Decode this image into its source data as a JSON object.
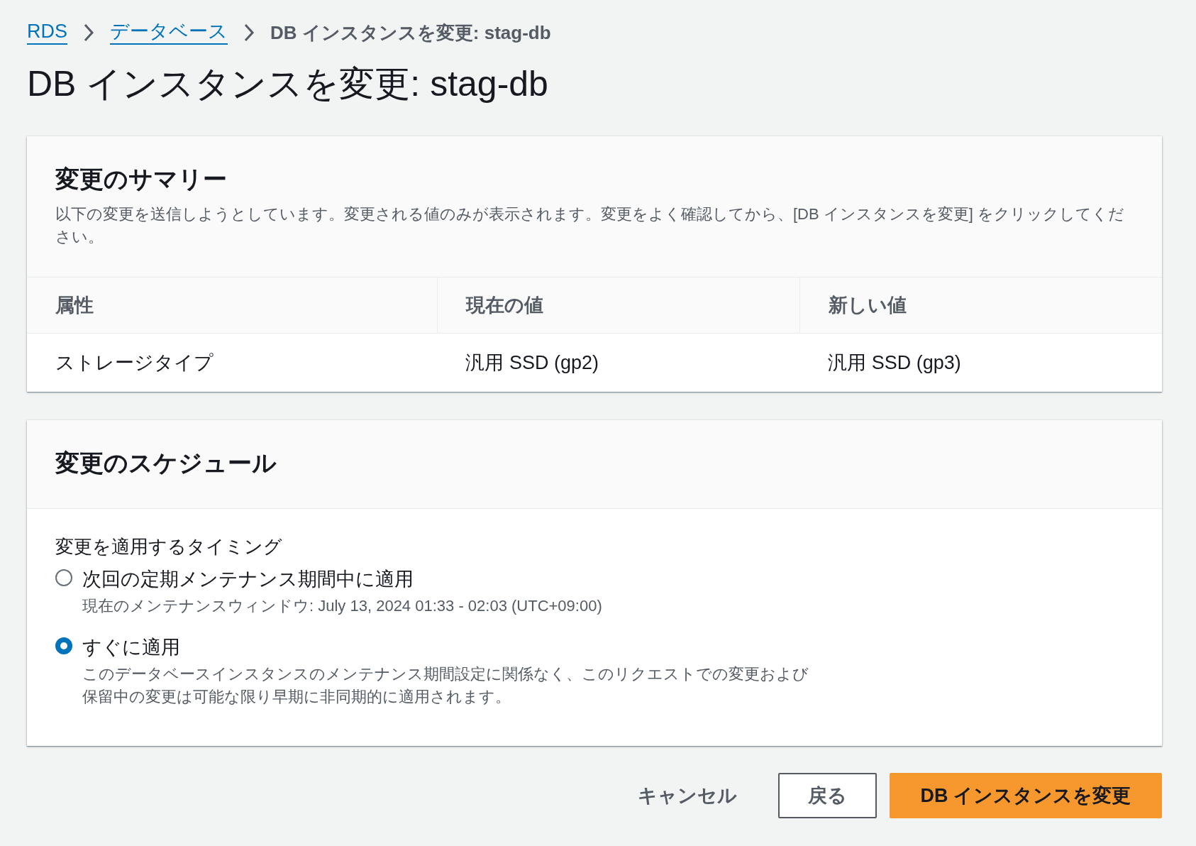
{
  "breadcrumbs": [
    {
      "label": "RDS",
      "kind": "link"
    },
    {
      "label": "データベース",
      "kind": "link"
    },
    {
      "label": "DB インスタンスを変更: stag-db",
      "kind": "current"
    }
  ],
  "title": "DB インスタンスを変更: stag-db",
  "summary": {
    "title": "変更のサマリー",
    "description": "以下の変更を送信しようとしています。変更される値のみが表示されます。変更をよく確認してから、[DB インスタンスを変更] をクリックしてください。",
    "columns": [
      "属性",
      "現在の値",
      "新しい値"
    ],
    "rows": [
      [
        "ストレージタイプ",
        "汎用 SSD (gp2)",
        "汎用 SSD (gp3)"
      ]
    ]
  },
  "schedule": {
    "title": "変更のスケジュール",
    "label": "変更を適用するタイミング",
    "options": [
      {
        "label": "次回の定期メンテナンス期間中に適用",
        "description": "現在のメンテナンスウィンドウ: July 13, 2024 01:33 - 02:03 (UTC+09:00)",
        "selected": false
      },
      {
        "label": "すぐに適用",
        "description": "このデータベースインスタンスのメンテナンス期間設定に関係なく、このリクエストでの変更および保留中の変更は可能な限り早期に非同期的に適用されます。",
        "selected": true
      }
    ]
  },
  "buttons": [
    {
      "label": "キャンセル",
      "kind": "link"
    },
    {
      "label": "戻る",
      "kind": "normal"
    },
    {
      "label": "DB インスタンスを変更",
      "kind": "primary"
    }
  ]
}
